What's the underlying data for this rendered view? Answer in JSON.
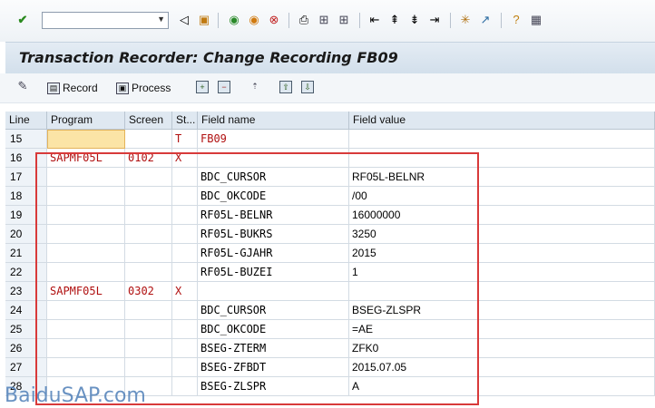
{
  "window": {
    "title": "Transaction Recorder: Change Recording FB09",
    "command_field_value": ""
  },
  "app_toolbar": {
    "record_label": "Record",
    "process_label": "Process"
  },
  "table": {
    "headers": [
      "Line",
      "Program",
      "Screen",
      "St...",
      "Field name",
      "Field value"
    ],
    "rows": [
      {
        "line": "15",
        "program": "",
        "screen": "",
        "st": "T",
        "field_name": "FB09",
        "field_value": ""
      },
      {
        "line": "16",
        "program": "SAPMF05L",
        "screen": "0102",
        "st": "X",
        "field_name": "",
        "field_value": ""
      },
      {
        "line": "17",
        "program": "",
        "screen": "",
        "st": "",
        "field_name": "BDC_CURSOR",
        "field_value": "RF05L-BELNR"
      },
      {
        "line": "18",
        "program": "",
        "screen": "",
        "st": "",
        "field_name": "BDC_OKCODE",
        "field_value": "/00"
      },
      {
        "line": "19",
        "program": "",
        "screen": "",
        "st": "",
        "field_name": "RF05L-BELNR",
        "field_value": "16000000"
      },
      {
        "line": "20",
        "program": "",
        "screen": "",
        "st": "",
        "field_name": "RF05L-BUKRS",
        "field_value": "3250"
      },
      {
        "line": "21",
        "program": "",
        "screen": "",
        "st": "",
        "field_name": "RF05L-GJAHR",
        "field_value": "2015"
      },
      {
        "line": "22",
        "program": "",
        "screen": "",
        "st": "",
        "field_name": "RF05L-BUZEI",
        "field_value": "1"
      },
      {
        "line": "23",
        "program": "SAPMF05L",
        "screen": "0302",
        "st": "X",
        "field_name": "",
        "field_value": ""
      },
      {
        "line": "24",
        "program": "",
        "screen": "",
        "st": "",
        "field_name": "BDC_CURSOR",
        "field_value": "BSEG-ZLSPR"
      },
      {
        "line": "25",
        "program": "",
        "screen": "",
        "st": "",
        "field_name": "BDC_OKCODE",
        "field_value": "=AE"
      },
      {
        "line": "26",
        "program": "",
        "screen": "",
        "st": "",
        "field_name": "BSEG-ZTERM",
        "field_value": "ZFK0"
      },
      {
        "line": "27",
        "program": "",
        "screen": "",
        "st": "",
        "field_name": "BSEG-ZFBDT",
        "field_value": "2015.07.05"
      },
      {
        "line": "28",
        "program": "",
        "screen": "",
        "st": "",
        "field_name": "BSEG-ZLSPR",
        "field_value": "A"
      }
    ]
  },
  "watermark": "BaiduSAP.com",
  "colors": {
    "accent_red": "#b01010",
    "highlight_border": "#d83a3a",
    "header_bg": "#dfe8f1"
  },
  "icons": [
    "check-icon",
    "back-icon",
    "save-icon",
    "nav-back-icon",
    "exit-icon",
    "cancel-icon",
    "print-icon",
    "find-icon",
    "find-next-icon",
    "first-page-icon",
    "prev-page-icon",
    "next-page-icon",
    "last-page-icon",
    "new-session-icon",
    "shortcut-icon",
    "help-icon",
    "layout-icon"
  ]
}
